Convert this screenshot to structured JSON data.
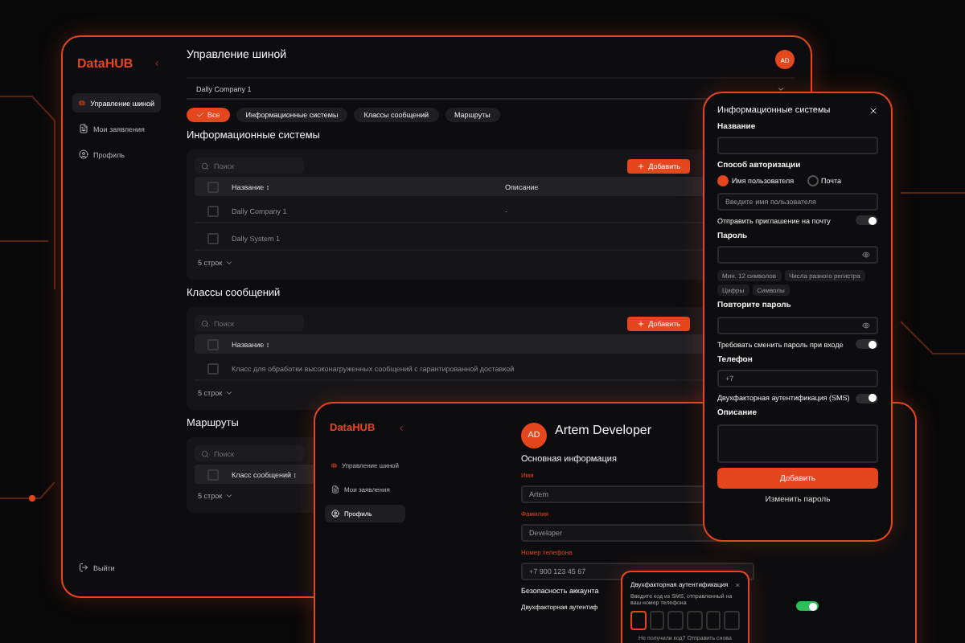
{
  "main_window": {
    "logo": "DataHUB",
    "sidebar": {
      "items": [
        {
          "label": "Управление шиной",
          "selected": true
        },
        {
          "label": "Мои заявления",
          "selected": false
        },
        {
          "label": "Профиль",
          "selected": false
        }
      ],
      "logout": "Выйти"
    },
    "title": "Управление шиной",
    "avatar": "AD",
    "company_select": "Dally Company 1",
    "filters": [
      {
        "label": "Все",
        "selected": true
      },
      {
        "label": "Информационные системы",
        "selected": false
      },
      {
        "label": "Классы сообщений",
        "selected": false
      },
      {
        "label": "Маршруты",
        "selected": false
      }
    ],
    "sections": [
      {
        "title": "Информационные системы",
        "search_placeholder": "Поиск",
        "add_button": "Добавить",
        "columns": [
          "Название ↕",
          "Описание"
        ],
        "rows": [
          {
            "checked": false,
            "cells": [
              "Dally Company 1",
              "-"
            ]
          },
          {
            "checked": false,
            "cells": [
              "Dally System 1",
              ""
            ]
          }
        ],
        "page_size": "5 строк"
      },
      {
        "title": "Классы сообщений",
        "search_placeholder": "Поиск",
        "add_button": "Добавить",
        "columns": [
          "Название ↕"
        ],
        "rows": [
          {
            "checked": false,
            "cells": [
              "Класс для обработки высоконагруженных сообщений с гарантированной доставкой"
            ]
          }
        ],
        "page_size": "5 строк"
      },
      {
        "title": "Маршруты",
        "search_placeholder": "Поиск",
        "columns": [
          "Класс сообщений ↕"
        ],
        "page_size": "5 строк"
      }
    ]
  },
  "modal": {
    "title": "Информационные системы",
    "name_label": "Название",
    "auth_label": "Способ авторизации",
    "auth_options": [
      {
        "label": "Имя пользователя",
        "selected": true
      },
      {
        "label": "Почта",
        "selected": false
      }
    ],
    "auth_placeholder": "Введите имя пользователя",
    "toggles": [
      {
        "label": "Отправить приглашение на почту",
        "on": true
      },
      {
        "label": "Требовать сменить пароль при входе",
        "on": true
      },
      {
        "label": "Двухфакторная аутентификация (SMS)",
        "on": true
      }
    ],
    "password_label": "Пароль",
    "password_hints": [
      "Мин. 12 символов",
      "Числа разного регистра",
      "Цифры",
      "Символы"
    ],
    "repeat_label": "Повторите пароль",
    "phone_label": "Телефон",
    "phone_value": "+7",
    "description_label": "Описание",
    "submit": "Добавить",
    "change_password": "Изменить пароль"
  },
  "profile_window": {
    "logo": "DataHUB",
    "sidebar": {
      "items": [
        {
          "label": "Управление шиной",
          "selected": false
        },
        {
          "label": "Мои заявления",
          "selected": false
        },
        {
          "label": "Профиль",
          "selected": true
        }
      ]
    },
    "avatar": "AD",
    "name": "Artem Developer",
    "section": "Основная информация",
    "fields": [
      {
        "label": "Имя",
        "value": "Artem"
      },
      {
        "label": "Фамилия",
        "value": "Developer"
      },
      {
        "label": "Номер телефона",
        "value": "+7 900 123 45 67"
      }
    ],
    "security_title": "Безопасность аккаунта",
    "twofa_label": "Двухфакторная аутентиф",
    "twofa_on": true
  },
  "twofa_dialog": {
    "title": "Двухфакторная аутентификация",
    "text": "Введите код из SMS, отправленный на ваш номер телефона",
    "resend": "Не получили код? Отправить снова"
  }
}
